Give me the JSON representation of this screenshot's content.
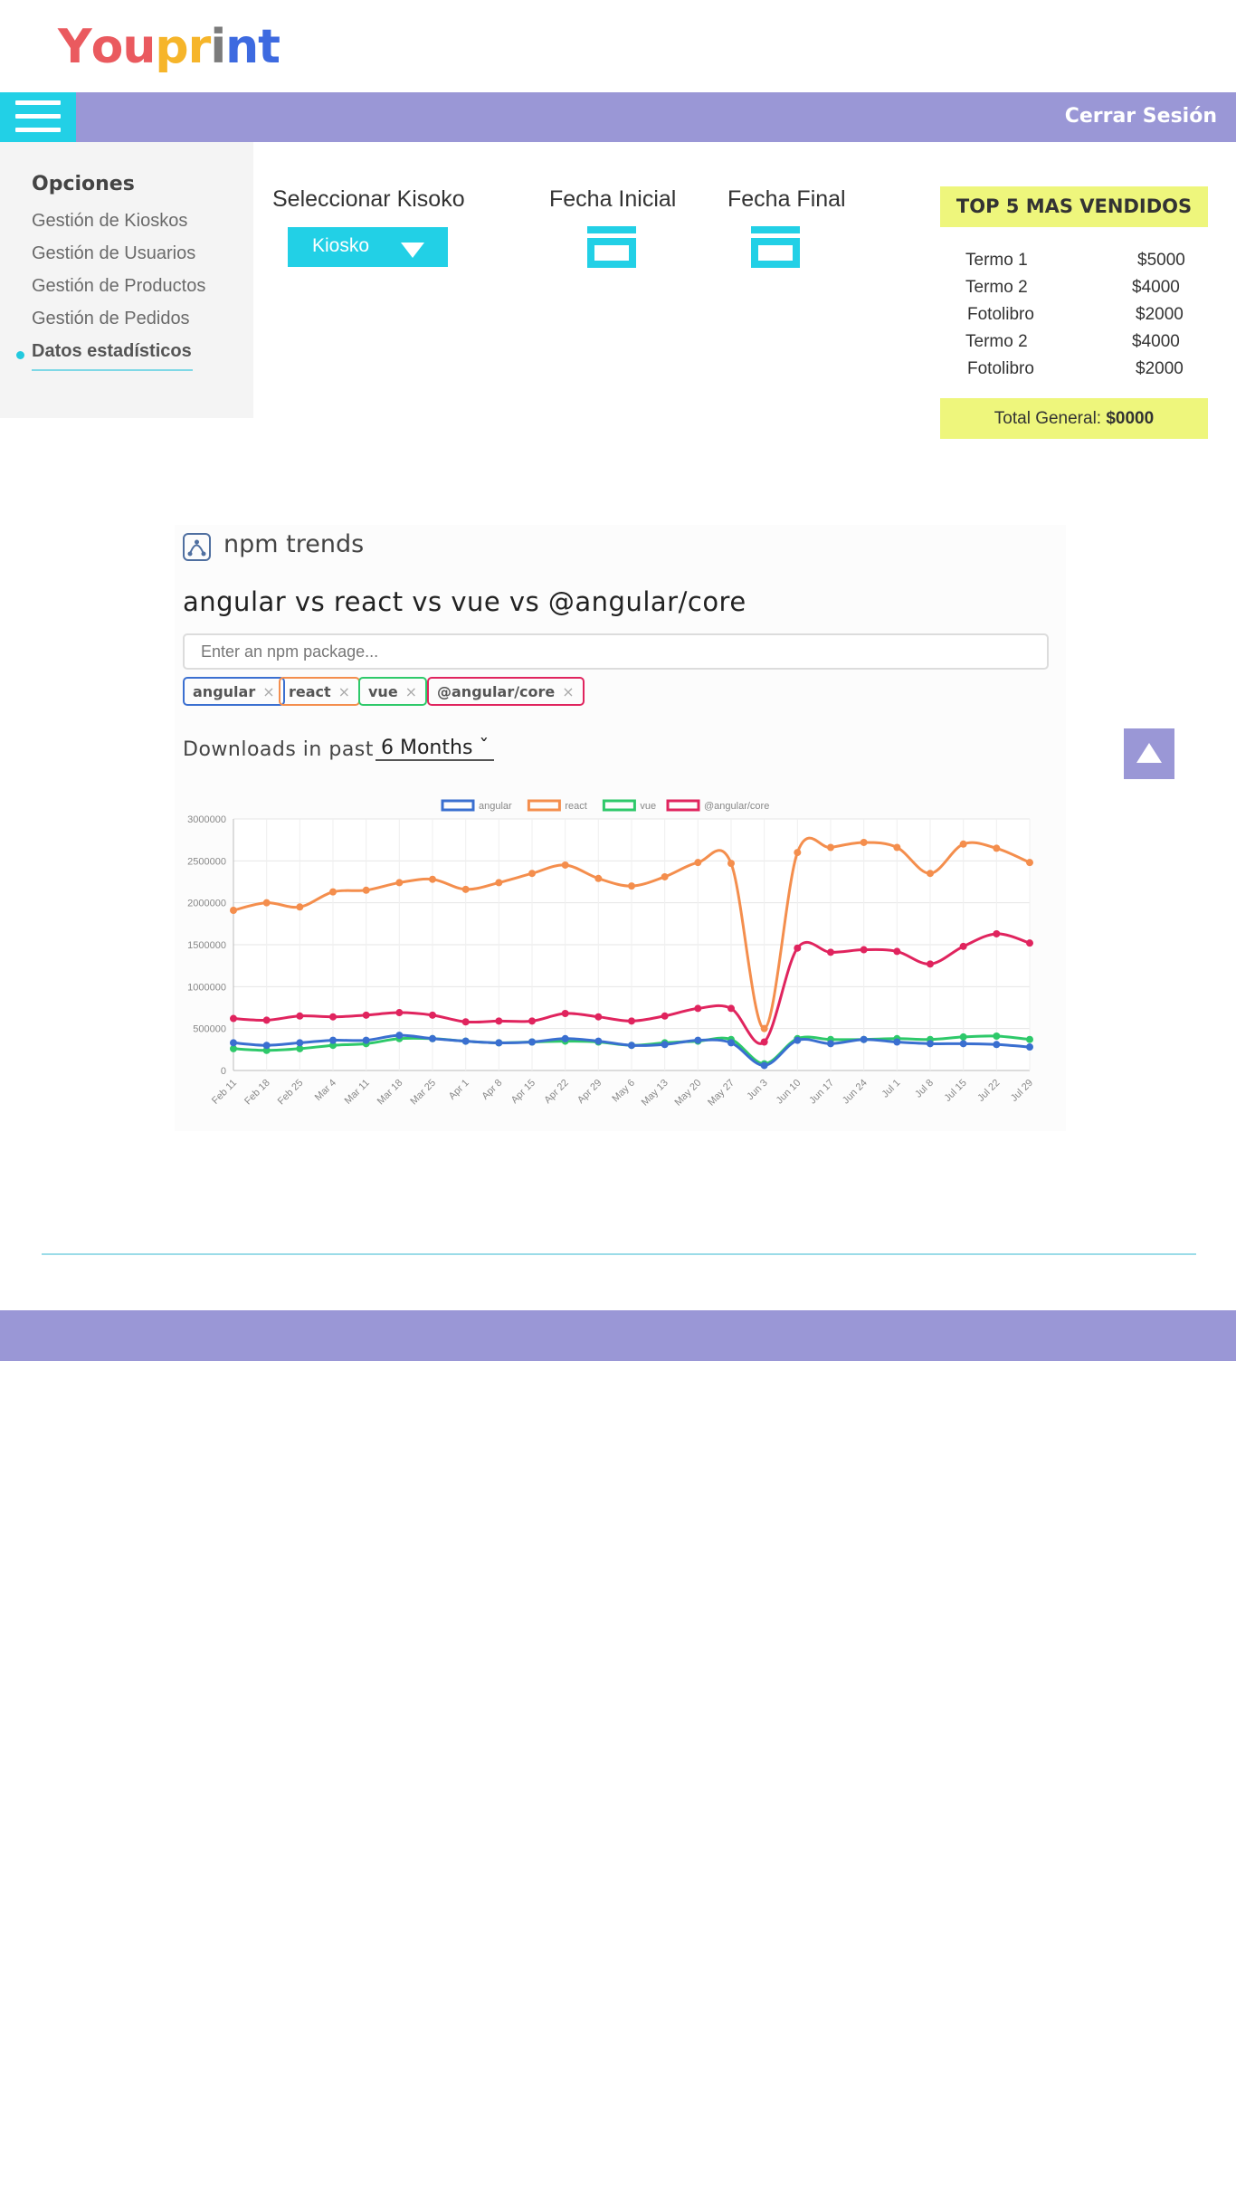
{
  "logo": {
    "letters": [
      "Y",
      "o",
      "u",
      "p",
      "r",
      "i",
      "n",
      "t"
    ],
    "colors": [
      "#ea5a5f",
      "#ea5a5f",
      "#ea5a5f",
      "#f6b52a",
      "#f6b52a",
      "#7b7b7b",
      "#3d6ae0",
      "#3d6ae0"
    ]
  },
  "header": {
    "menu_icon": "hamburger-icon",
    "logout_label": "Cerrar Sesión",
    "bar_color": "#9a97d6",
    "accent_color": "#22d0e6"
  },
  "sidebar": {
    "title": "Opciones",
    "items": [
      {
        "label": "Gestión de Kioskos",
        "active": false
      },
      {
        "label": "Gestión de Usuarios",
        "active": false
      },
      {
        "label": "Gestión de Productos",
        "active": false
      },
      {
        "label": "Gestión de Pedidos",
        "active": false
      },
      {
        "label": "Datos estadísticos",
        "active": true
      }
    ]
  },
  "filters": {
    "kiosk_label": "Seleccionar Kisoko",
    "kiosk_value": "Kiosko",
    "start_label": "Fecha Inicial",
    "end_label": "Fecha Final",
    "calendar_icon": "calendar-icon"
  },
  "top5": {
    "title": "TOP 5 MAS VENDIDOS",
    "items": [
      {
        "name": "Termo 1",
        "price": "$5000"
      },
      {
        "name": "Termo 2",
        "price": "$4000"
      },
      {
        "name": "Fotolibro",
        "price": "$2000"
      },
      {
        "name": "Termo 2",
        "price": "$4000"
      },
      {
        "name": "Fotolibro",
        "price": "$2000"
      }
    ],
    "total_label": "Total General:",
    "total_value": "$0000",
    "highlight_color": "#eef67c"
  },
  "trends": {
    "brand": "npm trends",
    "title": "angular vs react vs vue vs @angular/core",
    "search_placeholder": "Enter an npm package...",
    "tags": [
      {
        "label": "angular",
        "color": "#3a6fd0"
      },
      {
        "label": "react",
        "color": "#f48e4d"
      },
      {
        "label": "vue",
        "color": "#2ec96a"
      },
      {
        "label": "@angular/core",
        "color": "#e0245e"
      }
    ],
    "tag_close": "×",
    "downloads_label": "Downloads in past",
    "period": "6 Months ˇ"
  },
  "chart_data": {
    "type": "line",
    "x": [
      "Feb 11",
      "Feb 18",
      "Feb 25",
      "Mar 4",
      "Mar 11",
      "Mar 18",
      "Mar 25",
      "Apr 1",
      "Apr 8",
      "Apr 15",
      "Apr 22",
      "Apr 29",
      "May 6",
      "May 13",
      "May 20",
      "May 27",
      "Jun 3",
      "Jun 10",
      "Jun 17",
      "Jun 24",
      "Jul 1",
      "Jul 8",
      "Jul 15",
      "Jul 22",
      "Jul 29"
    ],
    "yticks": [
      0,
      500000,
      1000000,
      1500000,
      2000000,
      2500000,
      3000000
    ],
    "ylim": [
      0,
      3000000
    ],
    "grid": true,
    "legend_position": "top",
    "series": [
      {
        "name": "angular",
        "color": "#3a6fd0",
        "values": [
          330000,
          300000,
          330000,
          360000,
          360000,
          420000,
          380000,
          350000,
          330000,
          340000,
          380000,
          350000,
          300000,
          310000,
          360000,
          330000,
          60000,
          360000,
          320000,
          370000,
          340000,
          320000,
          320000,
          310000,
          280000
        ]
      },
      {
        "name": "react",
        "color": "#f48e4d",
        "values": [
          1910000,
          2000000,
          1950000,
          2130000,
          2150000,
          2240000,
          2280000,
          2160000,
          2240000,
          2350000,
          2450000,
          2290000,
          2200000,
          2310000,
          2480000,
          2470000,
          500000,
          2600000,
          2660000,
          2720000,
          2660000,
          2350000,
          2700000,
          2650000,
          2480000
        ]
      },
      {
        "name": "vue",
        "color": "#2ec96a",
        "values": [
          260000,
          240000,
          260000,
          300000,
          320000,
          380000,
          380000,
          350000,
          330000,
          340000,
          350000,
          340000,
          300000,
          330000,
          350000,
          370000,
          80000,
          380000,
          370000,
          370000,
          380000,
          370000,
          400000,
          410000,
          370000
        ]
      },
      {
        "name": "@angular/core",
        "color": "#e0245e",
        "values": [
          620000,
          600000,
          650000,
          640000,
          660000,
          690000,
          660000,
          580000,
          590000,
          590000,
          680000,
          640000,
          590000,
          650000,
          740000,
          740000,
          340000,
          1460000,
          1410000,
          1440000,
          1420000,
          1270000,
          1480000,
          1630000,
          1520000
        ]
      }
    ]
  }
}
